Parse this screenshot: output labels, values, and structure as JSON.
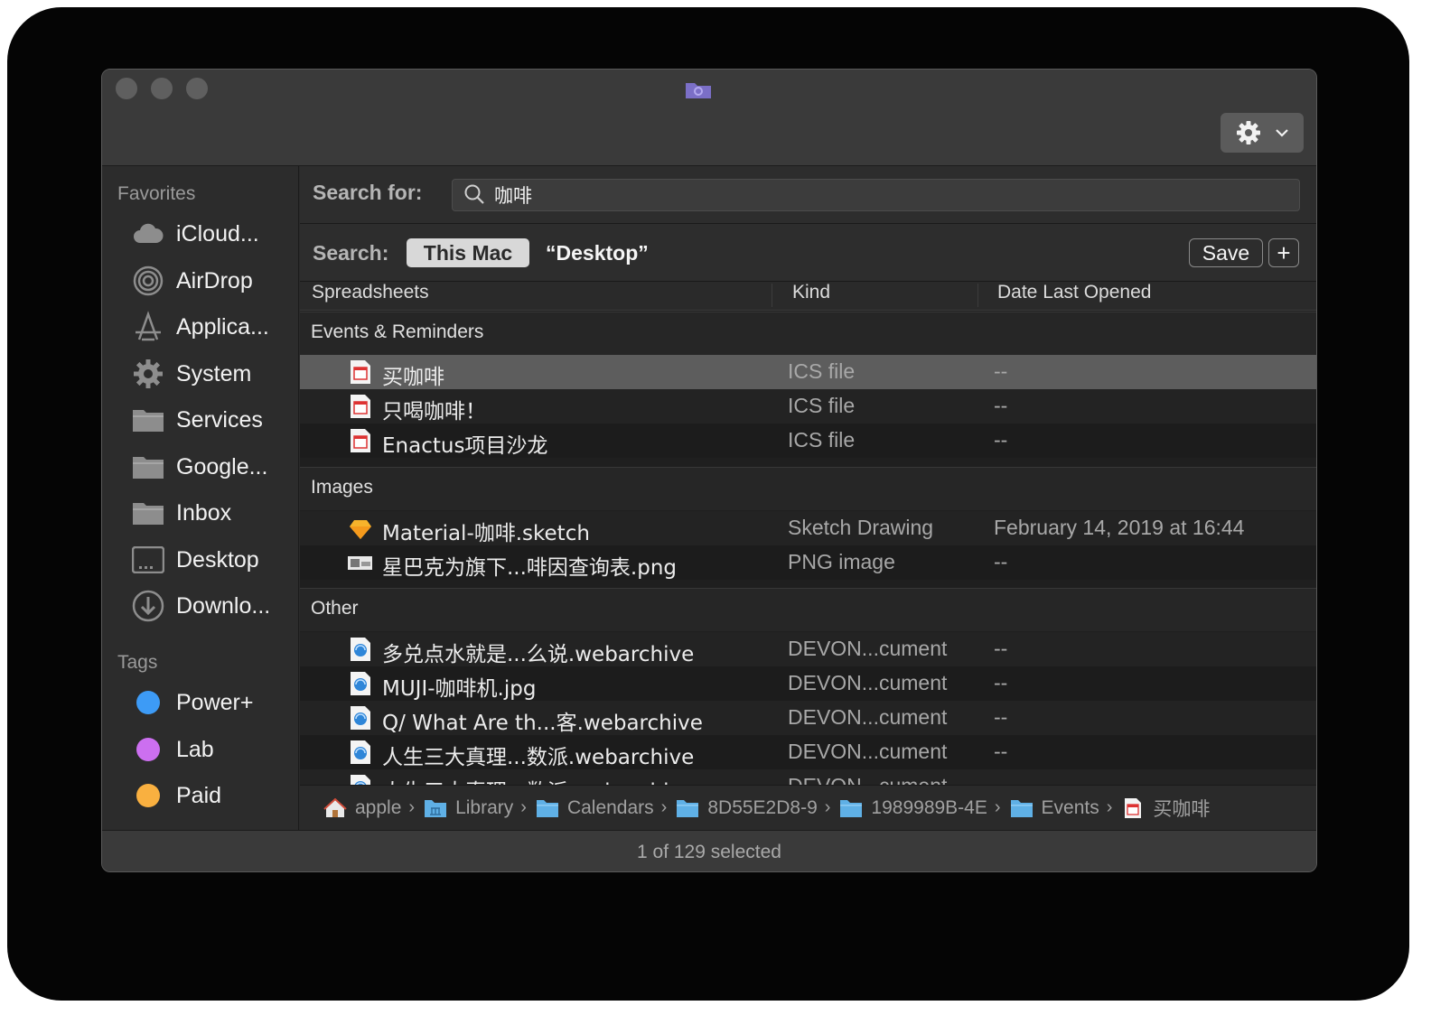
{
  "window": {
    "status": "1 of 129 selected"
  },
  "sidebar": {
    "favorites_header": "Favorites",
    "favorites": [
      {
        "label": "iCloud...",
        "icon": "cloud-icon"
      },
      {
        "label": "AirDrop",
        "icon": "airdrop-icon"
      },
      {
        "label": "Applica...",
        "icon": "applications-icon"
      },
      {
        "label": "System",
        "icon": "gear-icon"
      },
      {
        "label": "Services",
        "icon": "folder-icon"
      },
      {
        "label": "Google...",
        "icon": "folder-icon"
      },
      {
        "label": "Inbox",
        "icon": "folder-icon"
      },
      {
        "label": "Desktop",
        "icon": "desktop-icon"
      },
      {
        "label": "Downlo...",
        "icon": "download-icon"
      }
    ],
    "tags_header": "Tags",
    "tags": [
      {
        "label": "Power+",
        "color": "#3d9bf6"
      },
      {
        "label": "Lab",
        "color": "#cc6ff0"
      },
      {
        "label": "Paid",
        "color": "#f9b040"
      }
    ]
  },
  "search": {
    "label": "Search for:",
    "query": "咖啡",
    "scope_label": "Search:",
    "scope_this_mac": "This Mac",
    "scope_desktop": "“Desktop”",
    "save_label": "Save",
    "add_label": "+"
  },
  "columns": {
    "name": "Spreadsheets",
    "kind": "Kind",
    "date": "Date Last Opened"
  },
  "groups": [
    {
      "title": "Events & Reminders",
      "rows": [
        {
          "name": "买咖啡",
          "kind": "ICS file",
          "date": "--",
          "icon": "calendar-file-icon",
          "selected": true
        },
        {
          "name": "只喝咖啡！",
          "kind": "ICS file",
          "date": "--",
          "icon": "calendar-file-icon",
          "selected": false
        },
        {
          "name": "Enactus项目沙龙",
          "kind": "ICS file",
          "date": "--",
          "icon": "calendar-file-icon",
          "selected": false
        }
      ]
    },
    {
      "title": "Images",
      "rows": [
        {
          "name": "Material-咖啡.sketch",
          "kind": "Sketch Drawing",
          "date": "February 14, 2019 at 16:44",
          "icon": "sketch-file-icon",
          "selected": false
        },
        {
          "name": "星巴克为旗下...啡因查询表.png",
          "kind": "PNG image",
          "date": "--",
          "icon": "png-file-icon",
          "selected": false
        }
      ]
    },
    {
      "title": "Other",
      "rows": [
        {
          "name": "多兑点水就是...么说.webarchive",
          "kind": "DEVON...cument",
          "date": "--",
          "icon": "devonthink-file-icon",
          "selected": false
        },
        {
          "name": "MUJI-咖啡机.jpg",
          "kind": "DEVON...cument",
          "date": "--",
          "icon": "devonthink-file-icon",
          "selected": false
        },
        {
          "name": "Q/ What Are th...客.webarchive",
          "kind": "DEVON...cument",
          "date": "--",
          "icon": "devonthink-file-icon",
          "selected": false
        },
        {
          "name": "人生三大真理...数派.webarchive",
          "kind": "DEVON...cument",
          "date": "--",
          "icon": "devonthink-file-icon",
          "selected": false
        },
        {
          "name": "人生三大真理...数派.webarchive",
          "kind": "DEVON...cument",
          "date": "--",
          "icon": "devonthink-file-icon",
          "selected": false
        }
      ]
    }
  ],
  "path": [
    {
      "label": "apple",
      "icon": "home-icon"
    },
    {
      "label": "Library",
      "icon": "library-folder-icon"
    },
    {
      "label": "Calendars",
      "icon": "folder-icon"
    },
    {
      "label": "8D55E2D8-9",
      "icon": "folder-icon"
    },
    {
      "label": "1989989B-4E",
      "icon": "folder-icon"
    },
    {
      "label": "Events",
      "icon": "folder-icon"
    },
    {
      "label": "买咖啡",
      "icon": "calendar-file-icon"
    }
  ],
  "colors": {
    "accent_folder": "#5fb0e6",
    "selection": "#5d5d5d"
  }
}
